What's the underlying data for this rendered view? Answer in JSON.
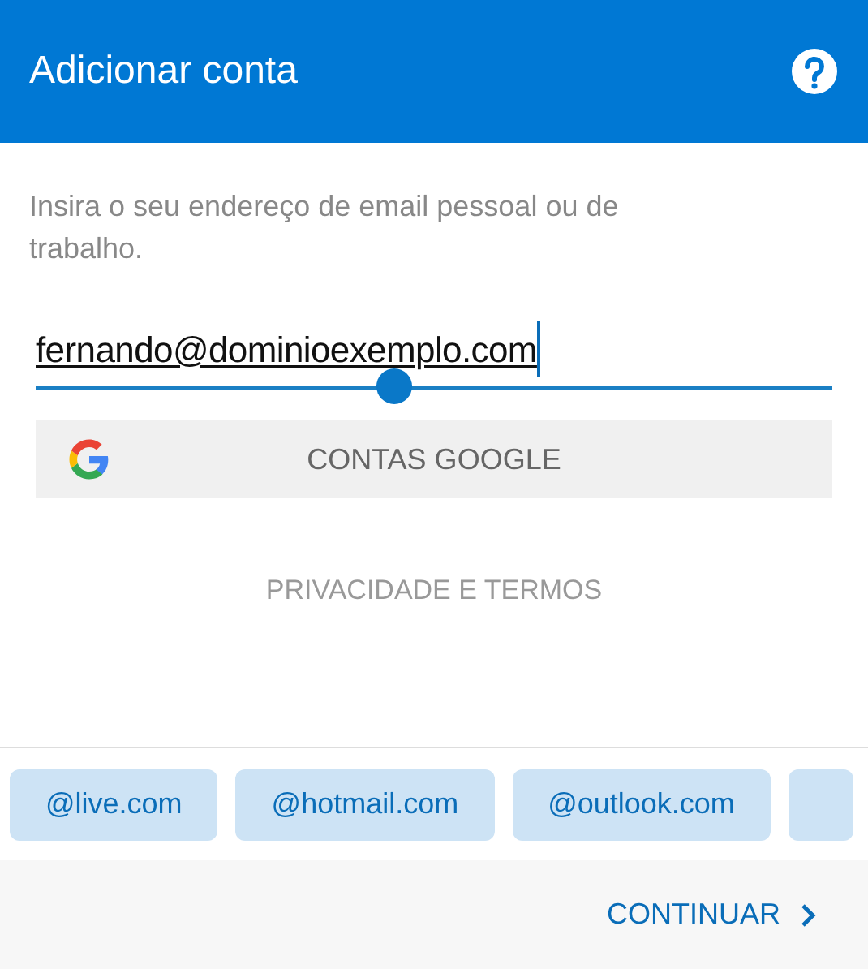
{
  "header": {
    "title": "Adicionar conta"
  },
  "instruction": "Insira o seu endereço de email pessoal ou de trabalho.",
  "email_field": {
    "value": "fernando@dominioexemplo.com",
    "focused": true
  },
  "google_button": {
    "label": "CONTAS GOOGLE"
  },
  "privacy_link": "PRIVACIDADE E TERMOS",
  "domain_chips": [
    "@live.com",
    "@hotmail.com",
    "@outlook.com"
  ],
  "continue_button": {
    "label": "CONTINUAR"
  }
}
